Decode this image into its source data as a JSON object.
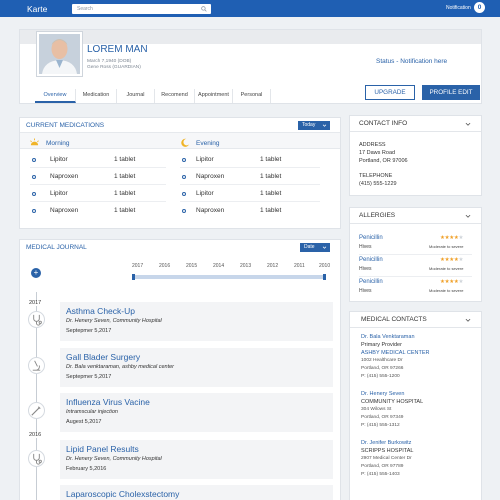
{
  "topbar": {
    "brand": "Karte",
    "search_placeholder": "Search",
    "notification_label": "Notification",
    "notification_count": "0"
  },
  "profile": {
    "name": "LOREM MAN",
    "dob": "March 7,1940 (DOB)",
    "guardian": "Gene Ross (GUARDIAN)",
    "status": "Status - Notification here",
    "upgrade_label": "UPGRADE",
    "edit_label": "PROFILE EDIT",
    "tabs": [
      "Overview",
      "Medication",
      "Journal",
      "Recomend",
      "Appointment",
      "Personal"
    ]
  },
  "medications": {
    "title": "CURRENT MEDICATIONS",
    "filter": "Today",
    "morning_label": "Morning",
    "evening_label": "Evening",
    "morning": [
      {
        "name": "Lipitor",
        "dose": "1 tablet"
      },
      {
        "name": "Naproxen",
        "dose": "1 tablet"
      },
      {
        "name": "Lipitor",
        "dose": "1 tablet"
      },
      {
        "name": "Naproxen",
        "dose": "1 tablet"
      }
    ],
    "evening": [
      {
        "name": "Lipitor",
        "dose": "1 tablet"
      },
      {
        "name": "Naproxen",
        "dose": "1 tablet"
      },
      {
        "name": "Lipitor",
        "dose": "1 tablet"
      },
      {
        "name": "Naproxen",
        "dose": "1 tablet"
      }
    ]
  },
  "journal": {
    "title": "MEDICAL JOURNAL",
    "filter": "Date",
    "timeline_years": [
      "2017",
      "2016",
      "2015",
      "2014",
      "2013",
      "2012",
      "2011",
      "2010"
    ],
    "year_2017": "2017",
    "year_2016": "2016",
    "entries": [
      {
        "title": "Asthma Check-Up",
        "sub": "Dr. Henery Seven, Community Hospital",
        "date": "Septepmer 5,2017"
      },
      {
        "title": "Gall Blader Surgery",
        "sub": "Dr. Bala venktaraman, ashby medical center",
        "date": "Septepmer 5,2017"
      },
      {
        "title": "Influenza Virus Vacine",
        "sub": "Intramscular injection",
        "date": "Augest 5,2017"
      },
      {
        "title": "Lipid Panel Results",
        "sub": "Dr. Henery Seven, Community Hospital",
        "date": "February 5,2016"
      },
      {
        "title": "Laparoscopic Cholexstectomy",
        "sub": "",
        "date": ""
      }
    ]
  },
  "contact": {
    "title": "CONTACT INFO",
    "address_label": "ADDRESS",
    "address1": "17 Daws Road",
    "address2": "Portland, OR 97006",
    "phone_label": "TELEPHONE",
    "phone": "(415) 555-1229"
  },
  "allergies": {
    "title": "ALLERGIES",
    "items": [
      {
        "name": "Penicillin",
        "type": "Hives",
        "severity": "Moderate to severe",
        "rating": 4
      },
      {
        "name": "Penicillin",
        "type": "Hives",
        "severity": "Moderate to severe",
        "rating": 4
      },
      {
        "name": "Penicillin",
        "type": "Hives",
        "severity": "Moderate to severe",
        "rating": 4
      }
    ]
  },
  "medical_contacts": {
    "title": "MEDICAL CONTACTS",
    "items": [
      {
        "name": "Dr. Bala Venktaraman",
        "role": "Primary Provider",
        "org": "ASHBY MEDICAL CENTER",
        "addr1": "1002 Healthcare Dr",
        "addr2": "Portland, OR 97266",
        "phone": "P: (415) 555-1200"
      },
      {
        "name": "Dr. Henery Seven",
        "role": "",
        "org": "COMMUNITY HOSPITAL",
        "addr1": "304 Wilows St",
        "addr2": "Portland, OR 97349",
        "phone": "P: (415) 555-1312"
      },
      {
        "name": "Dr. Jenifer Burkowitz",
        "role": "",
        "org": "SCRIPPS HOSPITAL",
        "addr1": "2907 Medical Center Dr",
        "addr2": "Portland, OR 97789",
        "phone": "P: (415) 555-1403"
      }
    ]
  },
  "colors": {
    "primary": "#2a62a8",
    "topbar": "#1f5fb3",
    "star": "#f0a12a",
    "background": "#eef1f4"
  },
  "icons": [
    "search-icon",
    "notification-badge",
    "sun-icon",
    "moon-icon",
    "plus-icon",
    "stethoscope-icon",
    "microscope-icon",
    "syringe-icon",
    "chevron-down-icon"
  ]
}
